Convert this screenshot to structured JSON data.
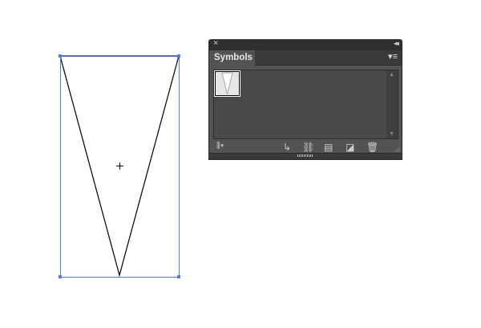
{
  "panel": {
    "tab_label": "Symbols",
    "close_icon": "close-icon",
    "collapse_icon": "double-chevron-left-icon",
    "menu_icon": "panel-menu-icon",
    "toolbar": [
      "symbol-libraries-icon",
      "place-symbol-icon",
      "break-link-icon",
      "symbol-options-icon",
      "new-symbol-icon",
      "delete-icon"
    ]
  },
  "colors": {
    "selection": "#4a7dff",
    "panel_bg": "#535353"
  }
}
